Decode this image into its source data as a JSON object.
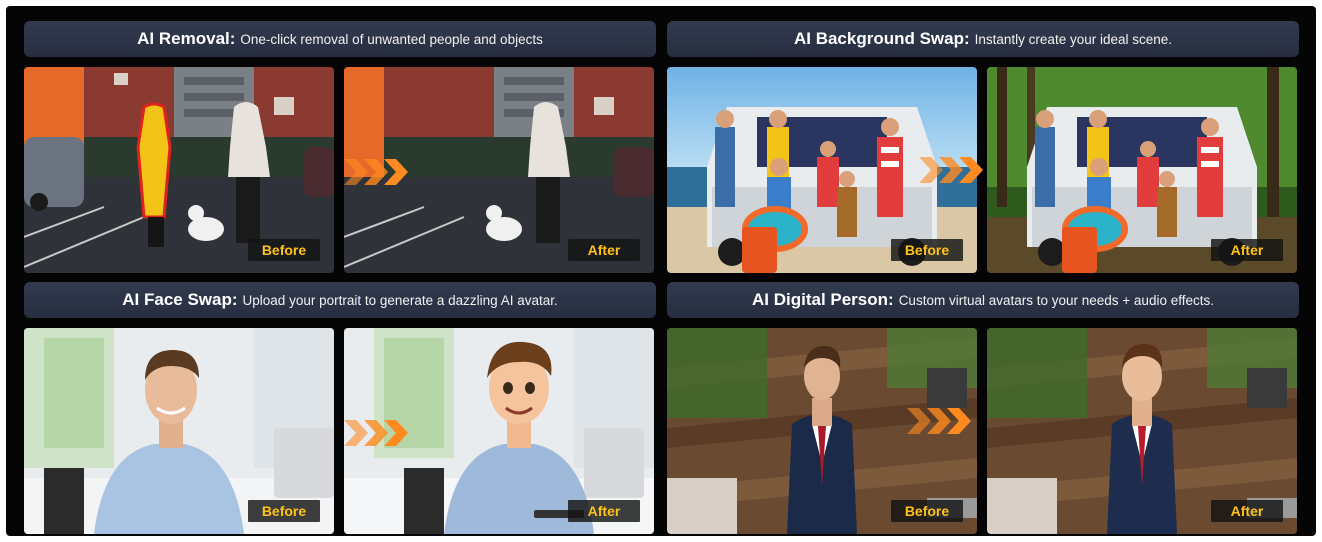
{
  "panels": {
    "removal": {
      "title": "AI Removal:",
      "description": "One-click removal of unwanted people and objects",
      "before_label": "Before",
      "after_label": "After"
    },
    "background": {
      "title": "AI Background Swap:",
      "description": "Instantly create your ideal scene.",
      "before_label": "Before",
      "after_label": "After"
    },
    "face": {
      "title": "AI Face Swap:",
      "description": "Upload your portrait to generate a dazzling AI avatar.",
      "before_label": "Before",
      "after_label": "After"
    },
    "digital": {
      "title": "AI Digital Person:",
      "description": "Custom virtual avatars to your needs + audio effects.",
      "before_label": "Before",
      "after_label": "After"
    }
  },
  "colors": {
    "background": "#050505",
    "banner": "#2b3245",
    "label_text": "#ffc21a",
    "arrow": "#ff8a1f"
  },
  "icons": {
    "transition": "triple-chevron-right-icon"
  }
}
